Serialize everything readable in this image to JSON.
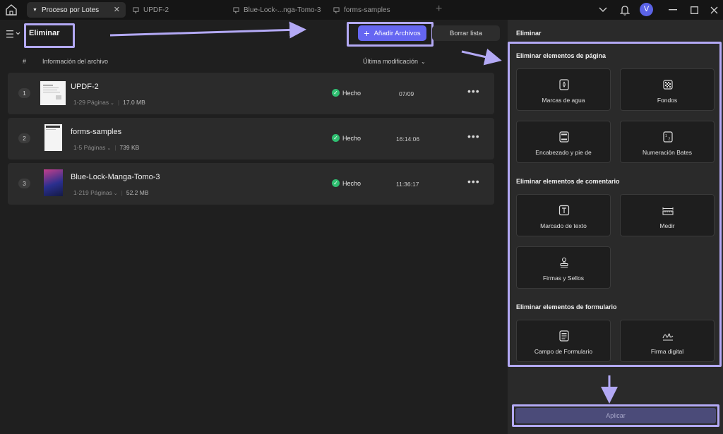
{
  "tabs": [
    {
      "label": "Proceso por Lotes",
      "active": true
    },
    {
      "label": "UPDF-2",
      "active": false
    },
    {
      "label": "Blue-Lock-...nga-Tomo-3",
      "active": false
    },
    {
      "label": "forms-samples",
      "active": false
    }
  ],
  "user": {
    "avatar_letter": "V"
  },
  "header": {
    "title": "Eliminar",
    "add_files": "Añadir Archivos",
    "clear_list": "Borrar lista"
  },
  "columns": {
    "number": "#",
    "file_info": "Información del archivo",
    "last_modified": "Última modificación"
  },
  "files": [
    {
      "index": "1",
      "name": "UPDF-2",
      "pages": "1-29 Páginas",
      "size": "17.0 MB",
      "status": "Hecho",
      "modified": "07/09"
    },
    {
      "index": "2",
      "name": "forms-samples",
      "pages": "1-5 Páginas",
      "size": "739 KB",
      "status": "Hecho",
      "modified": "16:14:06"
    },
    {
      "index": "3",
      "name": "Blue-Lock-Manga-Tomo-3",
      "pages": "1-219 Páginas",
      "size": "52.2 MB",
      "status": "Hecho",
      "modified": "11:36:17"
    }
  ],
  "panel": {
    "title": "Eliminar",
    "sections": [
      {
        "title": "Eliminar elementos de página",
        "items": [
          "Marcas de agua",
          "Fondos",
          "Encabezado y pie de",
          "Numeración Bates"
        ]
      },
      {
        "title": "Eliminar elementos de comentario",
        "items": [
          "Marcado de texto",
          "Medir",
          "Firmas y Sellos"
        ]
      },
      {
        "title": "Eliminar elementos de formulario",
        "items": [
          "Campo de Formulario",
          "Firma digital"
        ]
      }
    ],
    "apply": "Aplicar"
  },
  "colors": {
    "accent": "#6566f2",
    "highlight": "#b3a9f5",
    "success": "#2fbf71"
  }
}
